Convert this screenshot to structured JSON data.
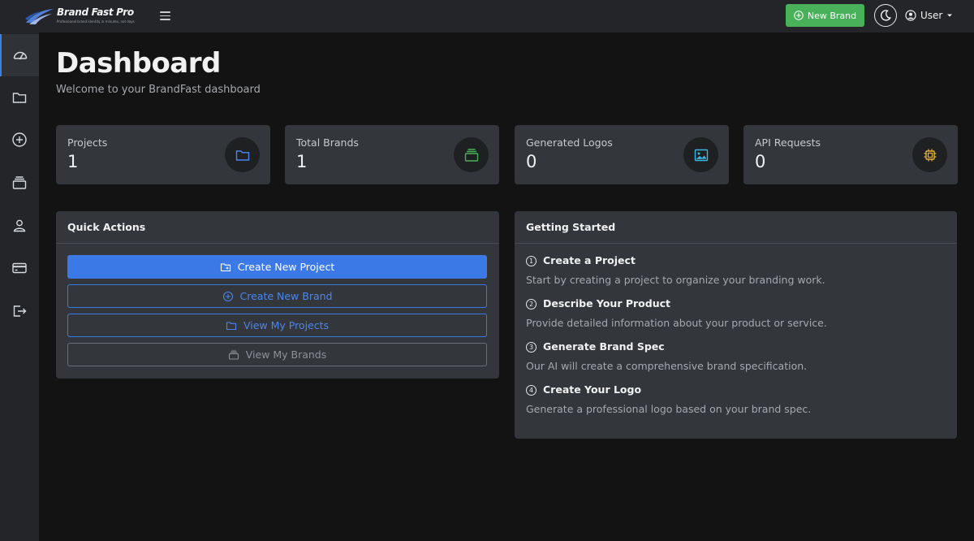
{
  "app": {
    "logo_name": "Brand Fast Pro",
    "logo_tagline": "Professional brand identity in minutes, not days"
  },
  "topbar": {
    "new_brand_label": "New Brand",
    "user_label": "User"
  },
  "sidebar": {
    "items": [
      {
        "icon": "dashboard-icon",
        "active": true
      },
      {
        "icon": "folder-icon"
      },
      {
        "icon": "plus-circle-icon"
      },
      {
        "icon": "stack-icon"
      },
      {
        "icon": "person-icon"
      },
      {
        "icon": "credit-card-icon"
      },
      {
        "icon": "logout-icon"
      }
    ]
  },
  "page": {
    "title": "Dashboard",
    "subtitle": "Welcome to your BrandFast dashboard"
  },
  "stats": [
    {
      "label": "Projects",
      "value": "1",
      "icon": "folder-icon",
      "color": "#4a86f0"
    },
    {
      "label": "Total Brands",
      "value": "1",
      "icon": "stack-icon",
      "color": "#49b15a"
    },
    {
      "label": "Generated Logos",
      "value": "0",
      "icon": "image-icon",
      "color": "#3ab8e0"
    },
    {
      "label": "API Requests",
      "value": "0",
      "icon": "cpu-icon",
      "color": "#e7b23a"
    }
  ],
  "quick_actions": {
    "title": "Quick Actions",
    "buttons": [
      {
        "label": "Create New Project",
        "icon": "folder-plus-icon"
      },
      {
        "label": "Create New Brand",
        "icon": "plus-circle-icon"
      },
      {
        "label": "View My Projects",
        "icon": "folder-icon"
      },
      {
        "label": "View My Brands",
        "icon": "stack-icon"
      }
    ]
  },
  "getting_started": {
    "title": "Getting Started",
    "steps": [
      {
        "num": "1",
        "title": "Create a Project",
        "desc": "Start by creating a project to organize your branding work."
      },
      {
        "num": "2",
        "title": "Describe Your Product",
        "desc": "Provide detailed information about your product or service."
      },
      {
        "num": "3",
        "title": "Generate Brand Spec",
        "desc": "Our AI will create a comprehensive brand specification."
      },
      {
        "num": "4",
        "title": "Create Your Logo",
        "desc": "Generate a professional logo based on your brand spec."
      }
    ]
  }
}
